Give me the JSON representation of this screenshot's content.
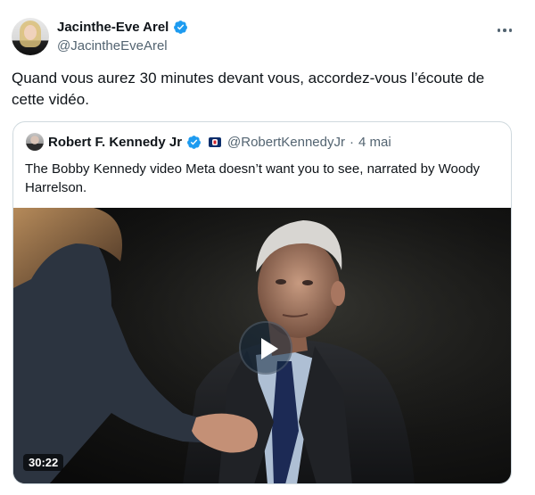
{
  "author": {
    "display_name": "Jacinthe-Eve Arel",
    "handle": "@JacintheEveArel",
    "verified": true
  },
  "tweet": {
    "text": "Quand vous aurez 30 minutes devant vous, accordez-vous l’écoute de cette vidéo."
  },
  "quoted": {
    "display_name": "Robert F. Kennedy Jr",
    "handle": "@RobertKennedyJr",
    "separator": "·",
    "date": "4 mai",
    "verified": true,
    "text": "The Bobby Kennedy video Meta doesn’t want you to see, narrated by Woody Harrelson.",
    "video": {
      "duration": "30:22"
    }
  },
  "icons": {
    "verified": "verified-badge-icon",
    "more": "more-options-icon",
    "play": "play-icon",
    "flag": "campaign-flag-icon"
  },
  "colors": {
    "primary_text": "#0f1419",
    "secondary_text": "#536471",
    "verified_blue": "#1d9bf0",
    "border": "#cfd9de"
  }
}
